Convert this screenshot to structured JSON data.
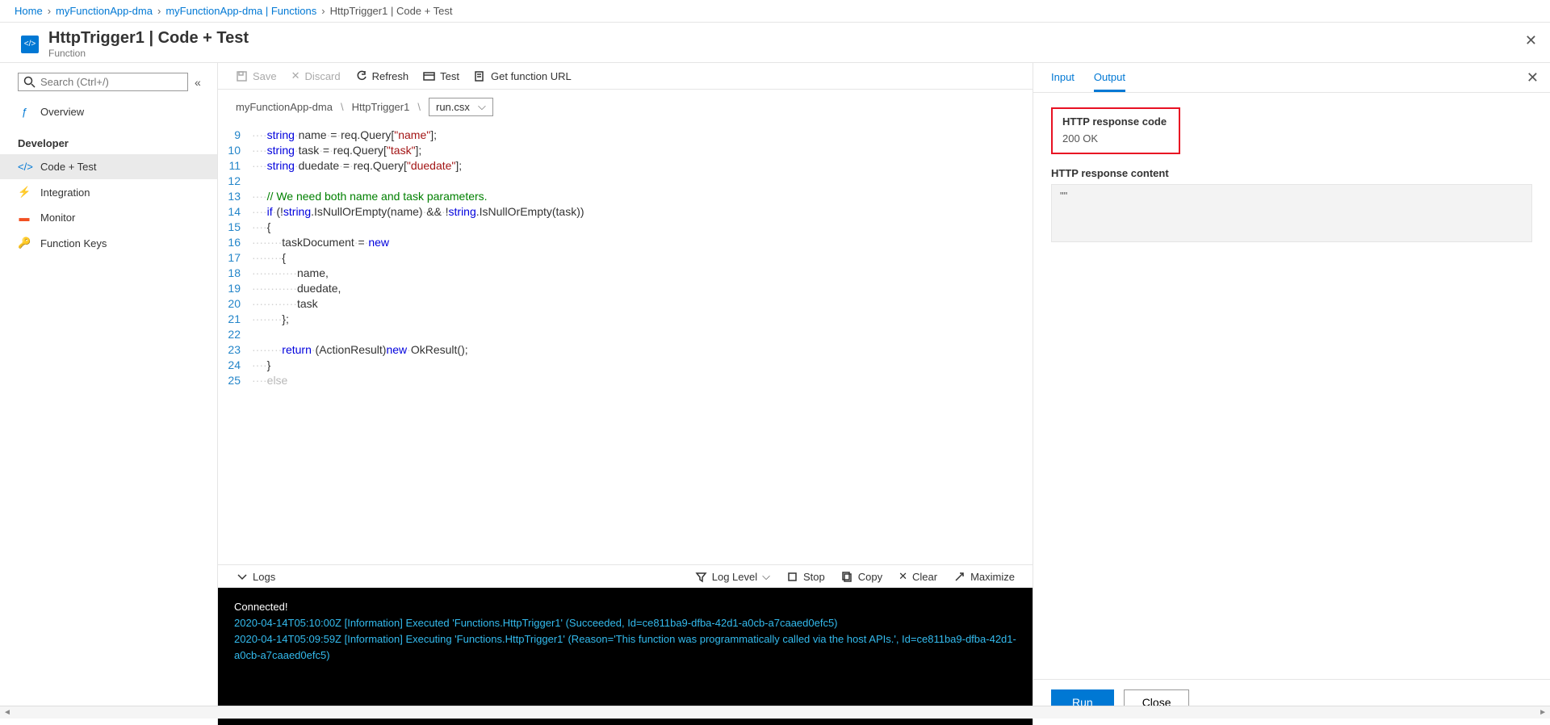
{
  "breadcrumb": {
    "home": "Home",
    "app": "myFunctionApp-dma",
    "functions": "myFunctionApp-dma | Functions",
    "current": "HttpTrigger1 | Code + Test"
  },
  "header": {
    "title": "HttpTrigger1 | Code + Test",
    "subtitle": "Function"
  },
  "search": {
    "placeholder": "Search (Ctrl+/)"
  },
  "nav": {
    "overview": "Overview",
    "developer_header": "Developer",
    "code_test": "Code + Test",
    "integration": "Integration",
    "monitor": "Monitor",
    "function_keys": "Function Keys"
  },
  "toolbar": {
    "save": "Save",
    "discard": "Discard",
    "refresh": "Refresh",
    "test": "Test",
    "get_url": "Get function URL"
  },
  "path": {
    "app": "myFunctionApp-dma",
    "func": "HttpTrigger1",
    "file": "run.csx"
  },
  "code_lines": [
    {
      "n": 9,
      "html": "<span class='ws'>····</span><span class='kw'>string</span><span class='ws'>·</span>name<span class='ws'>·</span>=<span class='ws'>·</span>req.Query[<span class='str'>\"name\"</span>];"
    },
    {
      "n": 10,
      "html": "<span class='ws'>····</span><span class='kw'>string</span><span class='ws'>·</span>task<span class='ws'>·</span>=<span class='ws'>·</span>req.Query[<span class='str'>\"task\"</span>];"
    },
    {
      "n": 11,
      "html": "<span class='ws'>····</span><span class='kw'>string</span><span class='ws'>·</span>duedate<span class='ws'>·</span>=<span class='ws'>·</span>req.Query[<span class='str'>\"duedate\"</span>];"
    },
    {
      "n": 12,
      "html": ""
    },
    {
      "n": 13,
      "html": "<span class='ws'>····</span><span class='cm'>// We need both name and task parameters.</span>"
    },
    {
      "n": 14,
      "html": "<span class='ws'>····</span><span class='kw'>if</span><span class='ws'>·</span>(!<span class='kw'>string</span>.IsNullOrEmpty(name)<span class='ws'>·</span>&amp;&amp;<span class='ws'>·</span>!<span class='kw'>string</span>.IsNullOrEmpty(task))"
    },
    {
      "n": 15,
      "html": "<span class='ws'>····</span>{"
    },
    {
      "n": 16,
      "html": "<span class='ws'>········</span>taskDocument<span class='ws'>·</span>=<span class='ws'>·</span><span class='kw'>new</span>"
    },
    {
      "n": 17,
      "html": "<span class='ws'>········</span>{"
    },
    {
      "n": 18,
      "html": "<span class='ws'>············</span>name,"
    },
    {
      "n": 19,
      "html": "<span class='ws'>············</span>duedate,"
    },
    {
      "n": 20,
      "html": "<span class='ws'>············</span>task"
    },
    {
      "n": 21,
      "html": "<span class='ws'>········</span>};"
    },
    {
      "n": 22,
      "html": ""
    },
    {
      "n": 23,
      "html": "<span class='ws'>········</span><span class='kw'>return</span><span class='ws'>·</span>(ActionResult)<span class='kw'>new</span><span class='ws'>·</span>OkResult();"
    },
    {
      "n": 24,
      "html": "<span class='ws'>····</span>}"
    },
    {
      "n": 25,
      "html": "<span class='ws'>····</span><span style='opacity:.35'>else</span>"
    }
  ],
  "logs": {
    "label": "Logs",
    "loglevel": "Log Level",
    "stop": "Stop",
    "copy": "Copy",
    "clear": "Clear",
    "maximize": "Maximize",
    "connected": "Connected!",
    "line1": "2020-04-14T05:10:00Z   [Information]   Executed 'Functions.HttpTrigger1' (Succeeded, Id=ce811ba9-dfba-42d1-a0cb-a7caaed0efc5)",
    "line2": "2020-04-14T05:09:59Z   [Information]   Executing 'Functions.HttpTrigger1' (Reason='This function was programmatically called via the host APIs.', Id=ce811ba9-dfba-42d1-a0cb-a7caaed0efc5)"
  },
  "tabs": {
    "input": "Input",
    "output": "Output"
  },
  "response": {
    "code_label": "HTTP response code",
    "code_value": "200 OK",
    "content_label": "HTTP response content",
    "content_value": "\"\""
  },
  "footer": {
    "run": "Run",
    "close": "Close"
  }
}
